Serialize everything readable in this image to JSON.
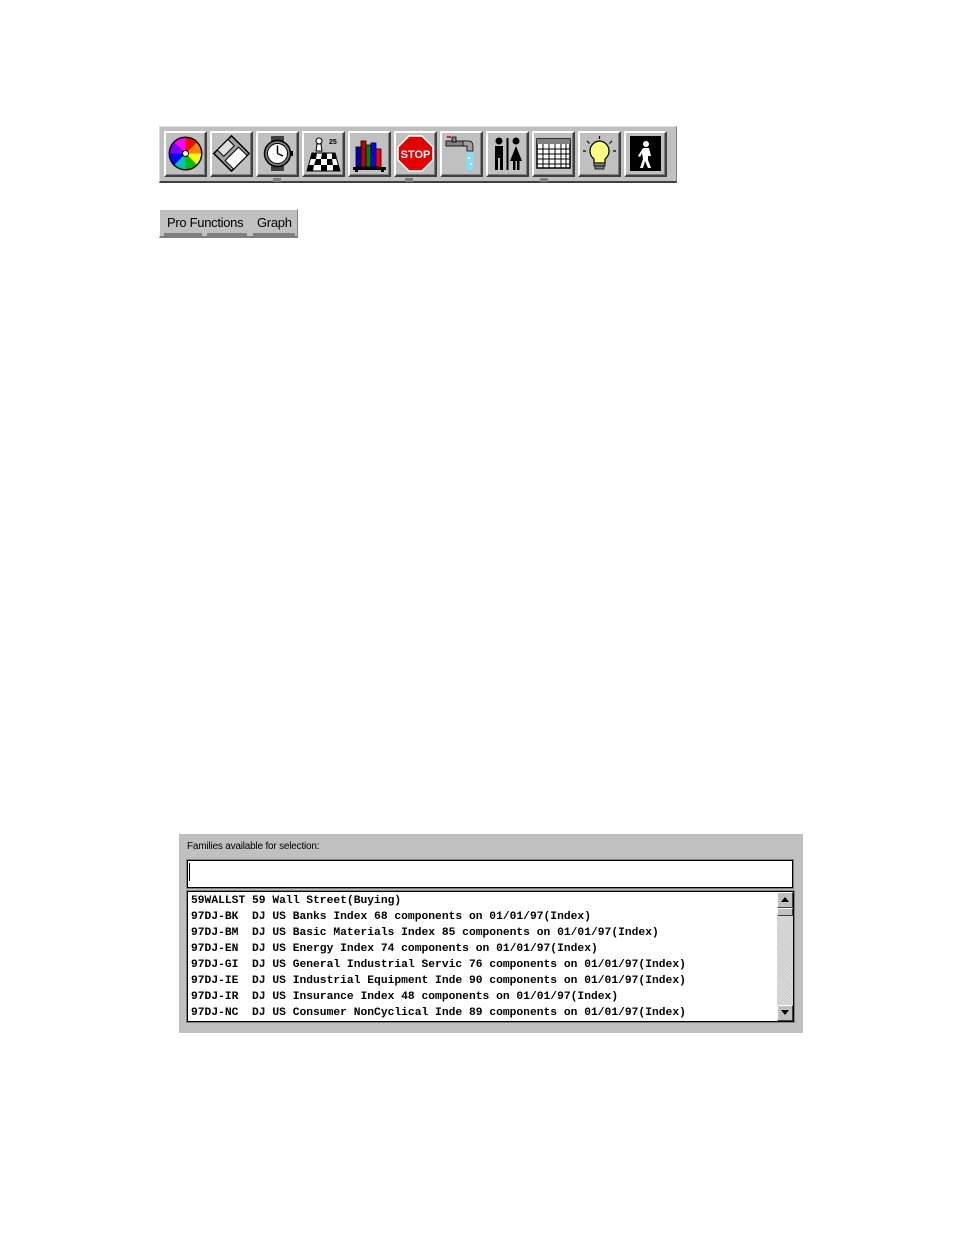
{
  "toolbar": {
    "buttons": [
      {
        "icon": "color-wheel-icon"
      },
      {
        "icon": "floppy-disk-icon"
      },
      {
        "icon": "wristwatch-icon"
      },
      {
        "icon": "chess-board-icon"
      },
      {
        "icon": "books-on-shelf-icon"
      },
      {
        "icon": "stop-sign-icon"
      },
      {
        "icon": "faucet-icon"
      },
      {
        "icon": "man-woman-icon"
      },
      {
        "icon": "spreadsheet-grid-icon"
      },
      {
        "icon": "light-bulb-icon"
      },
      {
        "icon": "exit-door-icon"
      }
    ],
    "stop_text": "STOP"
  },
  "menu": {
    "items": [
      {
        "label": "Pro Functions"
      },
      {
        "label": "Graph"
      }
    ]
  },
  "families_panel": {
    "label": "Families available for selection:",
    "input_value": "",
    "items": [
      "59WALLST 59 Wall Street(Buying)",
      "97DJ-BK  DJ US Banks Index 68 components on 01/01/97(Index)",
      "97DJ-BM  DJ US Basic Materials Index 85 components on 01/01/97(Index)",
      "97DJ-EN  DJ US Energy Index 74 components on 01/01/97(Index)",
      "97DJ-GI  DJ US General Industrial Servic 76 components on 01/01/97(Index)",
      "97DJ-IE  DJ US Industrial Equipment Inde 90 components on 01/01/97(Index)",
      "97DJ-IR  DJ US Insurance Index 48 components on 01/01/97(Index)",
      "97DJ-NC  DJ US Consumer NonCyclical Inde 89 components on 01/01/97(Index)"
    ]
  },
  "colors": {
    "face": "#c0c0c0",
    "stop_red": "#e00000"
  }
}
